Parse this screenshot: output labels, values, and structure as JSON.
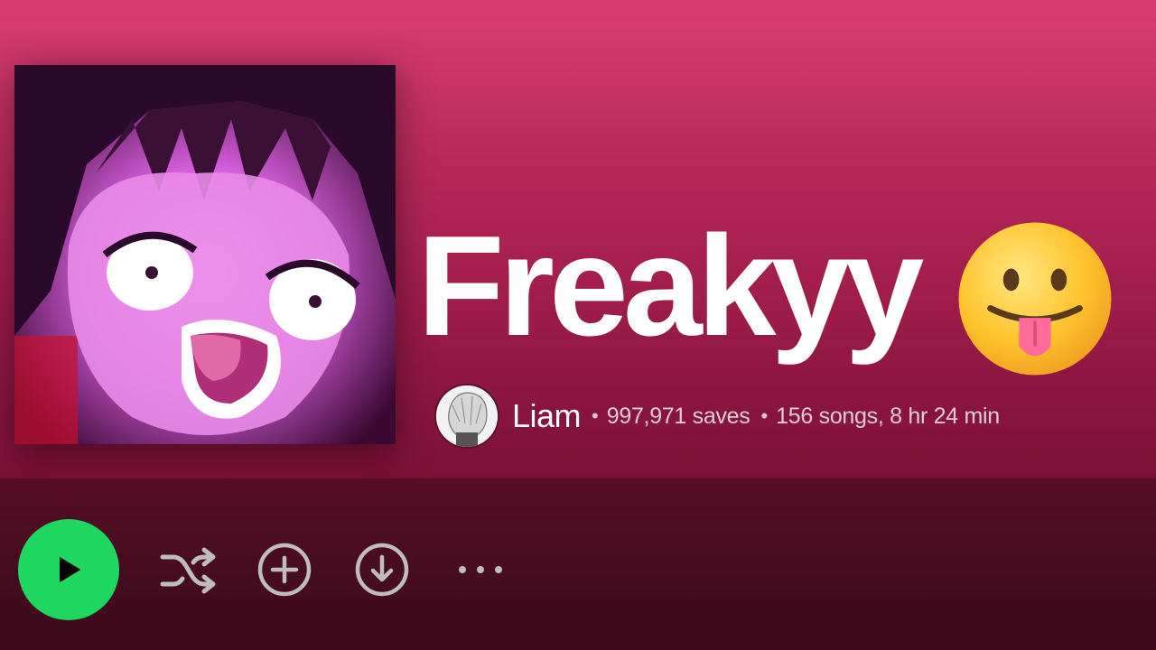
{
  "playlist": {
    "title": "Freakyy",
    "title_emoji": "face-with-tongue-emoji",
    "owner": "Liam",
    "separator": "•",
    "saves": "997,971 saves",
    "songs_duration": "156 songs, 8 hr 24 min"
  },
  "controls": {
    "play_icon": "play-icon",
    "shuffle_icon": "shuffle-icon",
    "add_icon": "add-circle-icon",
    "download_icon": "download-circle-icon",
    "more_icon": "more-options-icon"
  },
  "colors": {
    "accent_green": "#1ed760",
    "header_top": "#d93d72",
    "header_bottom": "#5a0c27",
    "control_gray": "#bdbdbd"
  }
}
